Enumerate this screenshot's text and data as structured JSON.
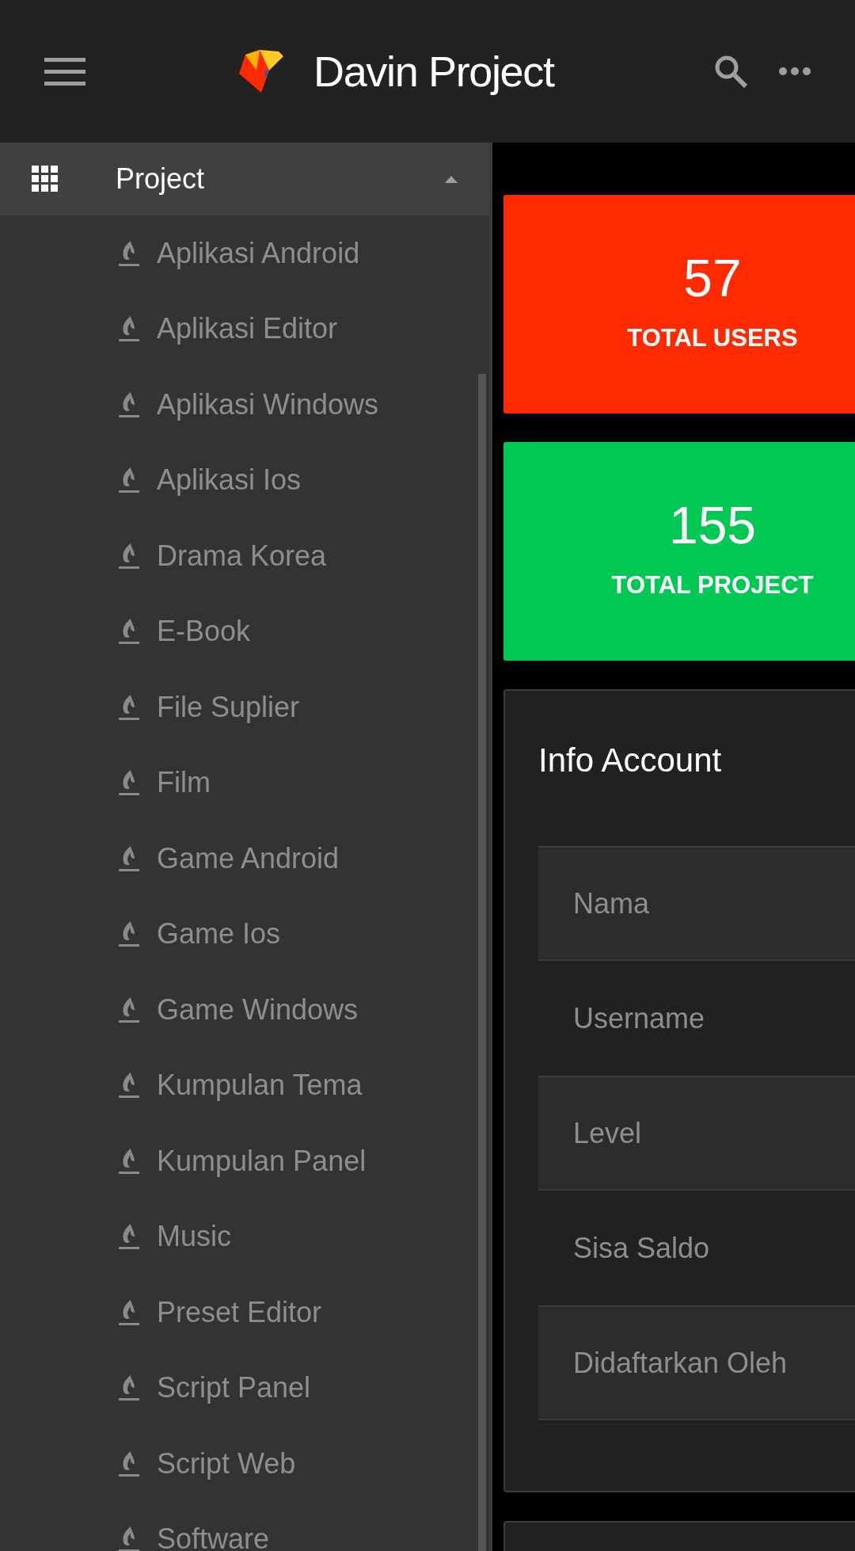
{
  "app_bar": {
    "title": "Davin Project"
  },
  "sidebar": {
    "section": {
      "label": "Project",
      "expanded": true
    },
    "items": [
      {
        "label": "Aplikasi Android"
      },
      {
        "label": "Aplikasi Editor"
      },
      {
        "label": "Aplikasi Windows"
      },
      {
        "label": "Aplikasi Ios"
      },
      {
        "label": "Drama Korea"
      },
      {
        "label": "E-Book"
      },
      {
        "label": "File Suplier"
      },
      {
        "label": "Film"
      },
      {
        "label": "Game Android"
      },
      {
        "label": "Game Ios"
      },
      {
        "label": "Game Windows"
      },
      {
        "label": "Kumpulan Tema"
      },
      {
        "label": "Kumpulan Panel"
      },
      {
        "label": "Music"
      },
      {
        "label": "Preset Editor"
      },
      {
        "label": "Script Panel"
      },
      {
        "label": "Script Web"
      },
      {
        "label": "Software"
      }
    ]
  },
  "stats": [
    {
      "value": "57",
      "label": "TOTAL USERS",
      "color": "#ff2a00"
    },
    {
      "value": "155",
      "label": "TOTAL PROJECT",
      "color": "#00c853"
    }
  ],
  "info_account": {
    "title": "Info Account",
    "rows": [
      {
        "label": "Nama"
      },
      {
        "label": "Username"
      },
      {
        "label": "Level"
      },
      {
        "label": "Sisa Saldo"
      },
      {
        "label": "Didaftarkan Oleh"
      }
    ]
  }
}
